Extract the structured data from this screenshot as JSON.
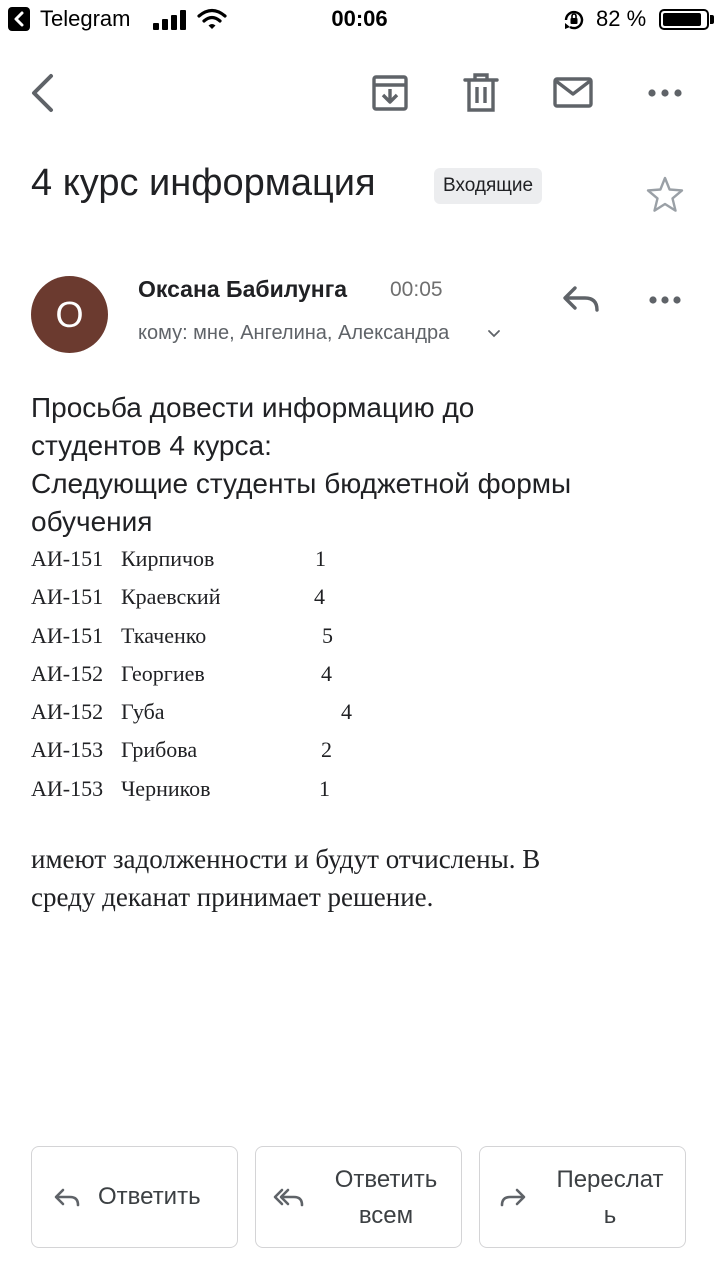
{
  "status_bar": {
    "app": "Telegram",
    "time": "00:06",
    "battery": "82 %",
    "battery_level": 0.82
  },
  "toolbar": {
    "back": "back-icon",
    "archive": "archive-icon",
    "delete": "trash-icon",
    "mark_unread": "mail-icon",
    "more": "more-icon"
  },
  "email": {
    "subject": "4 курс информация",
    "label": "Входящие",
    "sender": {
      "initial": "О",
      "name": "Оксана Бабилунга",
      "time": "00:05",
      "recipients": "кому: мне, Ангелина, Александра",
      "avatar_color": "#6b3a2f"
    },
    "intro_lines": [
      "Просьба довести информацию до",
      "студентов 4 курса:",
      "Следующие студенты бюджетной формы",
      "обучения"
    ],
    "students": [
      {
        "group": "АИ-151",
        "name": "Кирпичов",
        "count": "1"
      },
      {
        "group": "АИ-151",
        "name": "Краевский",
        "count": "4"
      },
      {
        "group": "АИ-151",
        "name": "Ткаченко",
        "count": "5"
      },
      {
        "group": "АИ-152",
        "name": "Георгиев",
        "count": "4"
      },
      {
        "group": "АИ-152",
        "name": "Губа",
        "count": "4"
      },
      {
        "group": "АИ-153",
        "name": "Грибова",
        "count": "2"
      },
      {
        "group": "АИ-153",
        "name": "Черников",
        "count": "1"
      }
    ],
    "closing_lines": [
      "имеют задолженности и будут отчислены. В",
      "среду деканат принимает решение."
    ]
  },
  "actions": {
    "reply": "Ответить",
    "reply_all_line1": "Ответить",
    "reply_all_line2": "всем",
    "forward_line1": "Переслат",
    "forward_line2": "ь"
  }
}
